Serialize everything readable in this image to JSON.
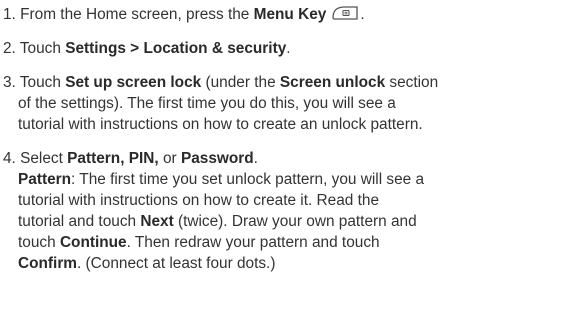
{
  "steps": [
    {
      "lines": [
        [
          {
            "t": "1. From the Home screen, press the "
          },
          {
            "t": "Menu Key",
            "b": true
          },
          {
            "icon": "menu-key-icon"
          },
          {
            "t": "."
          }
        ]
      ]
    },
    {
      "lines": [
        [
          {
            "t": "2. Touch "
          },
          {
            "t": "Settings > Location & security",
            "b": true
          },
          {
            "t": "."
          }
        ]
      ]
    },
    {
      "lines": [
        [
          {
            "t": "3. Touch "
          },
          {
            "t": "Set up screen lock",
            "b": true
          },
          {
            "t": " (under the "
          },
          {
            "t": "Screen unlock",
            "b": true
          },
          {
            "t": " section"
          }
        ],
        [
          {
            "t": "of the settings). The first time you do this, you will see a"
          }
        ],
        [
          {
            "t": "tutorial with instructions on how to create an unlock pattern."
          }
        ]
      ]
    },
    {
      "lines": [
        [
          {
            "t": "4. Select "
          },
          {
            "t": "Pattern, PIN,",
            "b": true
          },
          {
            "t": " or "
          },
          {
            "t": "Password",
            "b": true
          },
          {
            "t": "."
          }
        ],
        [
          {
            "t": "Pattern",
            "b": true
          },
          {
            "t": ": The first time you set unlock pattern, you will see a"
          }
        ],
        [
          {
            "t": "tutorial with instructions on how to create it. Read the"
          }
        ],
        [
          {
            "t": "tutorial and touch "
          },
          {
            "t": "Next",
            "b": true
          },
          {
            "t": " (twice). Draw your own pattern and"
          }
        ],
        [
          {
            "t": "touch "
          },
          {
            "t": "Continue",
            "b": true
          },
          {
            "t": ". Then redraw your pattern and touch"
          }
        ],
        [
          {
            "t": "Confirm",
            "b": true
          },
          {
            "t": ". (Connect at least four dots.)"
          }
        ]
      ]
    }
  ]
}
